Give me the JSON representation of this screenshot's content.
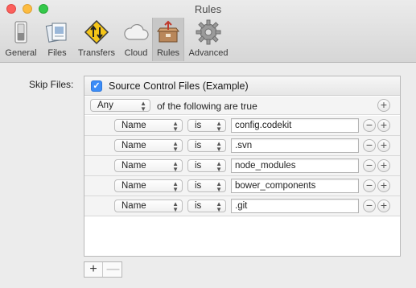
{
  "window": {
    "title": "Rules",
    "controls": [
      "close",
      "minimize",
      "maximize"
    ]
  },
  "toolbar": {
    "items": [
      {
        "label": "General",
        "icon": "general-switch-icon"
      },
      {
        "label": "Files",
        "icon": "files-icon"
      },
      {
        "label": "Transfers",
        "icon": "transfers-sign-icon"
      },
      {
        "label": "Cloud",
        "icon": "cloud-icon"
      },
      {
        "label": "Rules",
        "icon": "rules-box-icon",
        "selected": true
      },
      {
        "label": "Advanced",
        "icon": "gear-icon"
      }
    ]
  },
  "skip_files": {
    "label": "Skip Files:",
    "checkbox_checked": true,
    "rule_set_name": "Source Control Files (Example)",
    "match_mode": "Any",
    "match_suffix": "of the following are true",
    "rules": [
      {
        "field": "Name",
        "operator": "is",
        "value": "config.codekit"
      },
      {
        "field": "Name",
        "operator": "is",
        "value": ".svn"
      },
      {
        "field": "Name",
        "operator": "is",
        "value": "node_modules"
      },
      {
        "field": "Name",
        "operator": "is",
        "value": "bower_components"
      },
      {
        "field": "Name",
        "operator": "is",
        "value": ".git"
      }
    ],
    "add_rule_symbol": "+",
    "remove_rule_symbol": "−"
  },
  "bottom_buttons": {
    "add": "+",
    "remove": "—"
  },
  "colors": {
    "accent": "#3b8cf7",
    "close": "#fc605c",
    "minimize": "#fdbc40",
    "maximize": "#34c84a"
  }
}
